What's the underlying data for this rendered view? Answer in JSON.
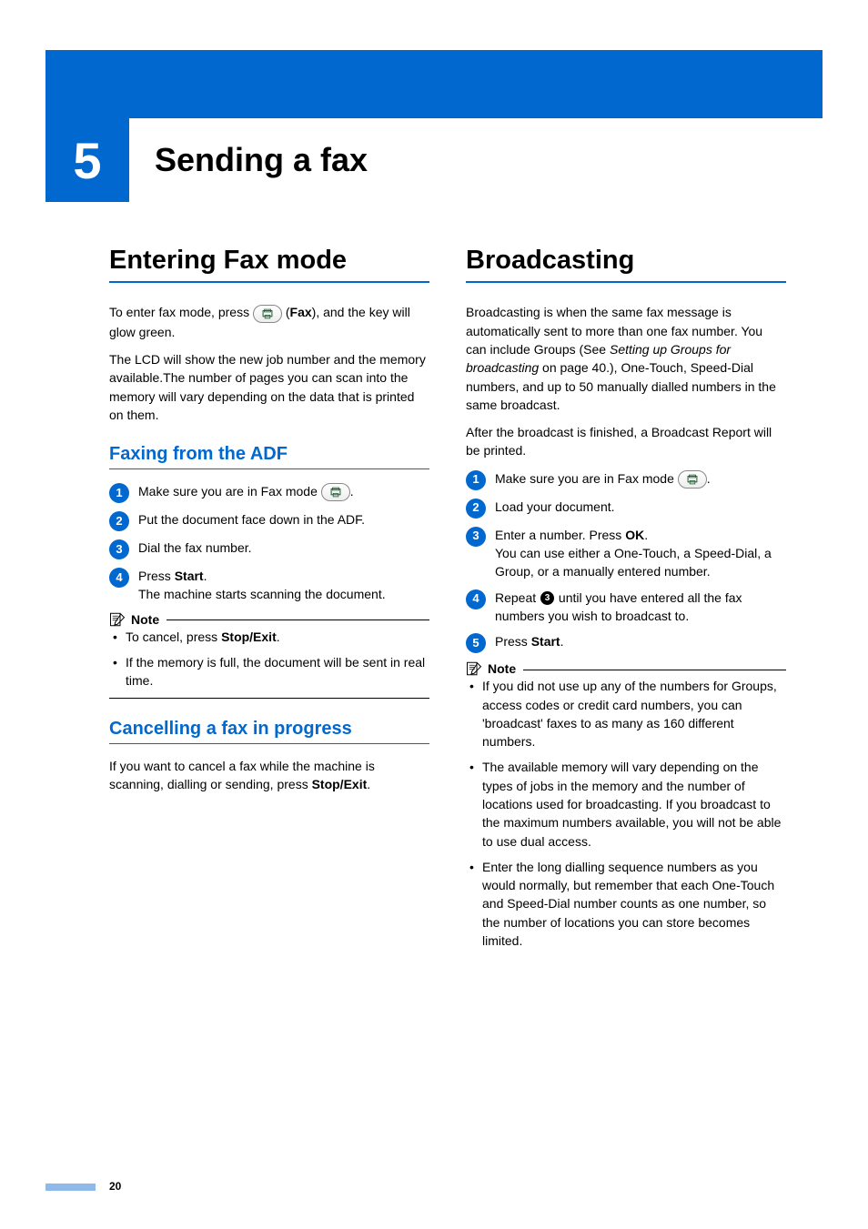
{
  "chapter": {
    "number": "5",
    "title": "Sending a fax"
  },
  "left": {
    "h1": "Entering Fax mode",
    "intro_pre": "To enter fax mode, press ",
    "intro_fax_label": "Fax",
    "intro_post": ", and the key will glow green.",
    "lcd_para": "The LCD will show the new job number and the memory available.The number of pages you can scan into the memory will vary depending on the data that is printed on them.",
    "h2a": "Faxing from the ADF",
    "steps": {
      "s1": "Make sure you are in Fax mode ",
      "s2": "Put the document face down in the ADF.",
      "s3": "Dial the fax number.",
      "s4_pre": "Press ",
      "s4_bold": "Start",
      "s4_post": ".",
      "s4_line2": "The machine starts scanning the document."
    },
    "note_label": "Note",
    "note_items": {
      "n1_pre": "To cancel, press ",
      "n1_bold": "Stop/Exit",
      "n1_post": ".",
      "n2": "If the memory is full, the document will be sent in real time."
    },
    "h2b": "Cancelling a fax in progress",
    "cancel_para_pre": "If you want to cancel a fax while the machine is scanning, dialling or sending, press ",
    "cancel_bold": "Stop/Exit",
    "cancel_post": "."
  },
  "right": {
    "h1": "Broadcasting",
    "p1_pre": "Broadcasting is when the same fax message is automatically sent to more than one fax number. You can include Groups (See ",
    "p1_italic": "Setting up Groups for broadcasting",
    "p1_mid": " on page 40.), One-Touch, Speed-Dial numbers, and up to 50 manually dialled numbers in the same broadcast.",
    "p2": "After the broadcast is finished, a Broadcast Report will be printed.",
    "steps": {
      "s1": "Make sure you are in Fax mode ",
      "s2": "Load your document.",
      "s3_pre": "Enter a number. Press ",
      "s3_bold": "OK",
      "s3_post": ".",
      "s3_line2": "You can use either a One-Touch, a Speed-Dial, a Group, or a manually entered number.",
      "s4_pre": "Repeat ",
      "s4_ref": "3",
      "s4_post": " until you have entered all the fax numbers you wish to broadcast to.",
      "s5_pre": "Press ",
      "s5_bold": "Start",
      "s5_post": "."
    },
    "note_label": "Note",
    "note_items": {
      "n1": "If you did not use up any of the numbers for Groups, access codes or credit card numbers, you can 'broadcast' faxes to as many as 160 different numbers.",
      "n2": "The available memory will vary depending on the types of jobs in the memory and the number of locations used for broadcasting. If you broadcast to the maximum numbers available, you will not be able to use dual access.",
      "n3": "Enter the long dialling sequence numbers as you would normally, but remember that each One-Touch and Speed-Dial number counts as one number, so the number of locations you can store becomes limited."
    }
  },
  "page_number": "20"
}
